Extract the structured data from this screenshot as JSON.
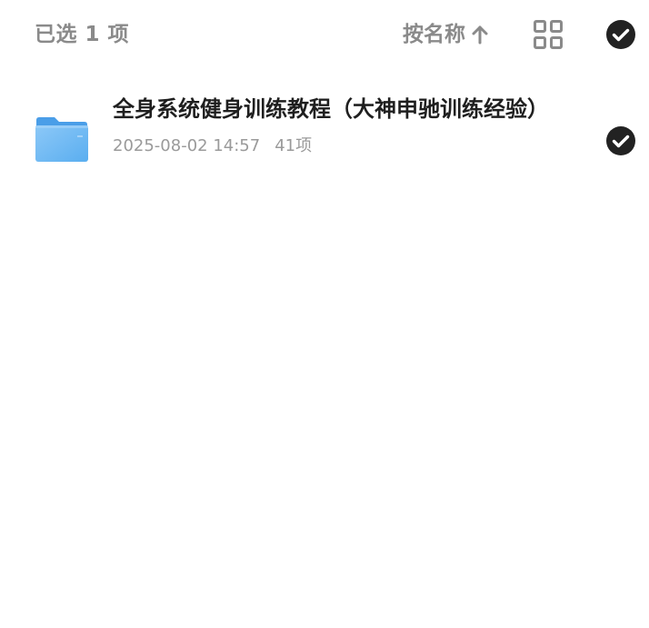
{
  "header": {
    "selected_count": "已选 1 项",
    "sort_label": "按名称"
  },
  "icons": {
    "sort": "arrow-up-icon",
    "view": "grid-view-icon",
    "select_all": "check-circle-icon",
    "folder": "folder-icon",
    "row_check": "check-circle-icon"
  },
  "files": [
    {
      "name": "全身系统健身训练教程（大神申驰训练经验）",
      "date": "2025-08-02 14:57",
      "count": "41项",
      "selected": true
    }
  ],
  "colors": {
    "header_text": "#8a8a8a",
    "name_text": "#1f1f1f",
    "meta_text": "#9a9a9a",
    "check_fill": "#222222",
    "folder_blue": "#5aaef0"
  }
}
